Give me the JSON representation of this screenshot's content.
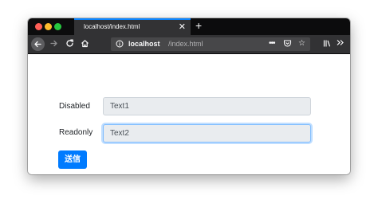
{
  "browser": {
    "tab_title": "localhost/index.html",
    "tab_close": "✕",
    "new_tab": "+",
    "url_host": "localhost",
    "url_path": "/index.html",
    "icons": [
      "back-icon",
      "forward-icon",
      "reload-icon",
      "home-icon",
      "info-icon",
      "more-icon",
      "pocket-icon",
      "bookmark-star-icon",
      "library-icon",
      "overflow-icon",
      "menu-icon"
    ]
  },
  "form": {
    "disabled_label": "Disabled",
    "disabled_value": "Text1",
    "readonly_label": "Readonly",
    "readonly_value": "Text2",
    "submit_label": "送信"
  },
  "colors": {
    "tab_accent": "#0a84ff",
    "button": "#007bff",
    "field_bg": "#e9ecef",
    "focus_border": "#80bdff"
  }
}
